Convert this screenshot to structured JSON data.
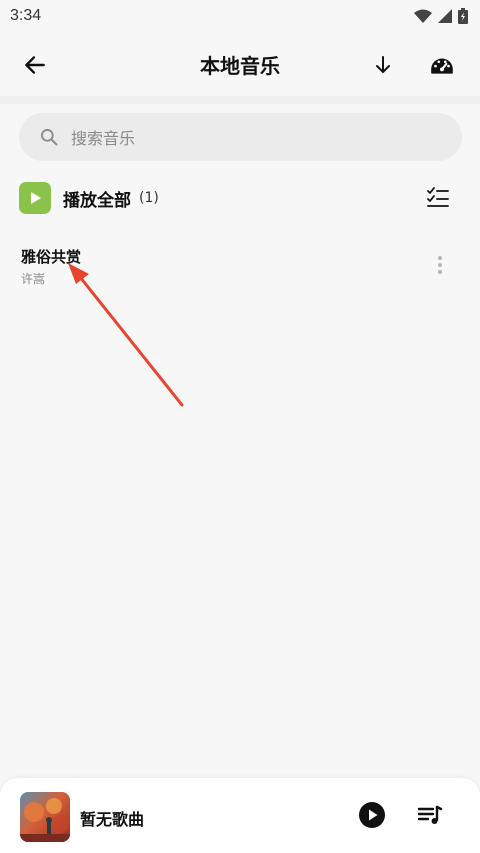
{
  "status_bar": {
    "time": "3:34",
    "icons": [
      "wifi-icon",
      "signal-icon",
      "battery-icon"
    ]
  },
  "header": {
    "title": "本地音乐",
    "back_icon": "arrow-left-icon",
    "download_icon": "arrow-down-icon",
    "speed_icon": "speedometer-icon"
  },
  "search": {
    "placeholder": "搜索音乐",
    "icon": "search-icon"
  },
  "play_all": {
    "label": "播放全部",
    "count": "(1)",
    "icon": "play-icon",
    "accent_color": "#8bc34a",
    "multiselect_icon": "checklist-icon"
  },
  "songs": [
    {
      "title": "雅俗共赏",
      "artist": "许嵩"
    }
  ],
  "mini_player": {
    "title": "暂无歌曲",
    "play_icon": "play-circle-icon",
    "queue_icon": "playlist-icon"
  },
  "annotation": {
    "arrow_color": "#e8432d"
  }
}
